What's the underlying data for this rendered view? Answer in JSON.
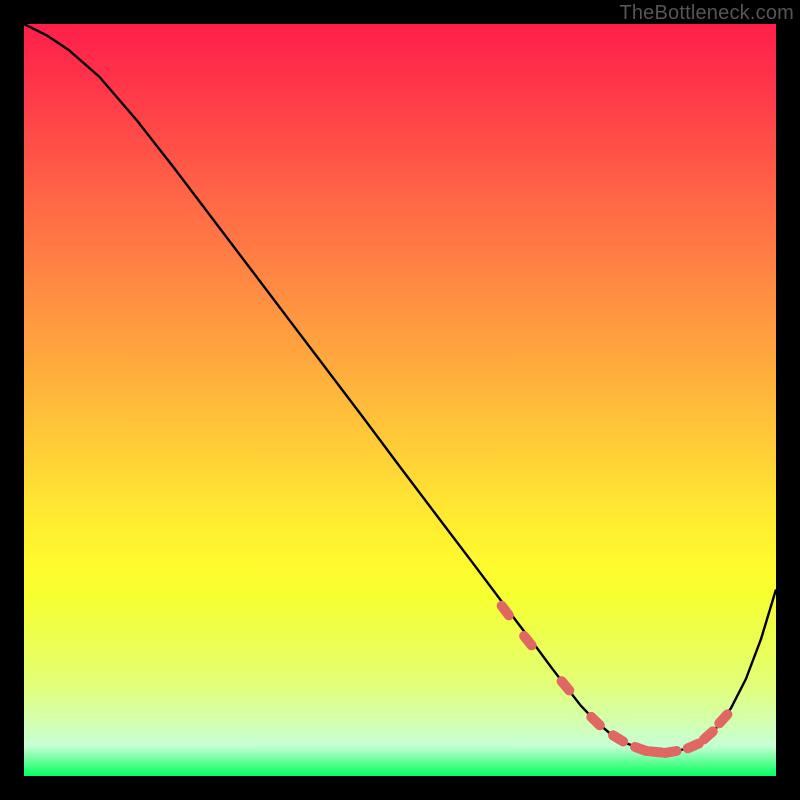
{
  "watermark": "TheBottleneck.com",
  "colors": {
    "gradient_top": "#ff1f49",
    "gradient_mid": "#ffec31",
    "gradient_bottom": "#00ff66",
    "curve": "#000000",
    "marker": "#e06762",
    "frame": "#000000"
  },
  "chart_data": {
    "type": "line",
    "title": "",
    "xlabel": "",
    "ylabel": "",
    "xlim": [
      0,
      100
    ],
    "ylim": [
      0,
      100
    ],
    "grid": false,
    "legend": false,
    "x": [
      0,
      3,
      6,
      10,
      15,
      20,
      25,
      30,
      35,
      40,
      45,
      50,
      55,
      60,
      63,
      66,
      68,
      70,
      72,
      74,
      76,
      78,
      80,
      82,
      84,
      86,
      88,
      90,
      92,
      94,
      96,
      98,
      100
    ],
    "y": [
      100,
      98.5,
      96.5,
      93,
      87.2,
      80.8,
      74.2,
      67.6,
      61.0,
      54.4,
      47.8,
      41.1,
      34.5,
      27.9,
      23.9,
      19.9,
      17.3,
      14.6,
      12.0,
      9.4,
      7.3,
      5.6,
      4.4,
      3.6,
      3.2,
      3.2,
      3.6,
      4.6,
      6.3,
      9.0,
      12.9,
      18.2,
      24.8
    ],
    "markers": {
      "x": [
        64,
        67,
        72,
        76,
        79,
        82,
        84,
        86,
        89,
        91,
        93
      ],
      "y": [
        22.0,
        18.0,
        12.0,
        7.3,
        5.0,
        3.6,
        3.2,
        3.2,
        4.0,
        5.4,
        7.6
      ]
    }
  }
}
